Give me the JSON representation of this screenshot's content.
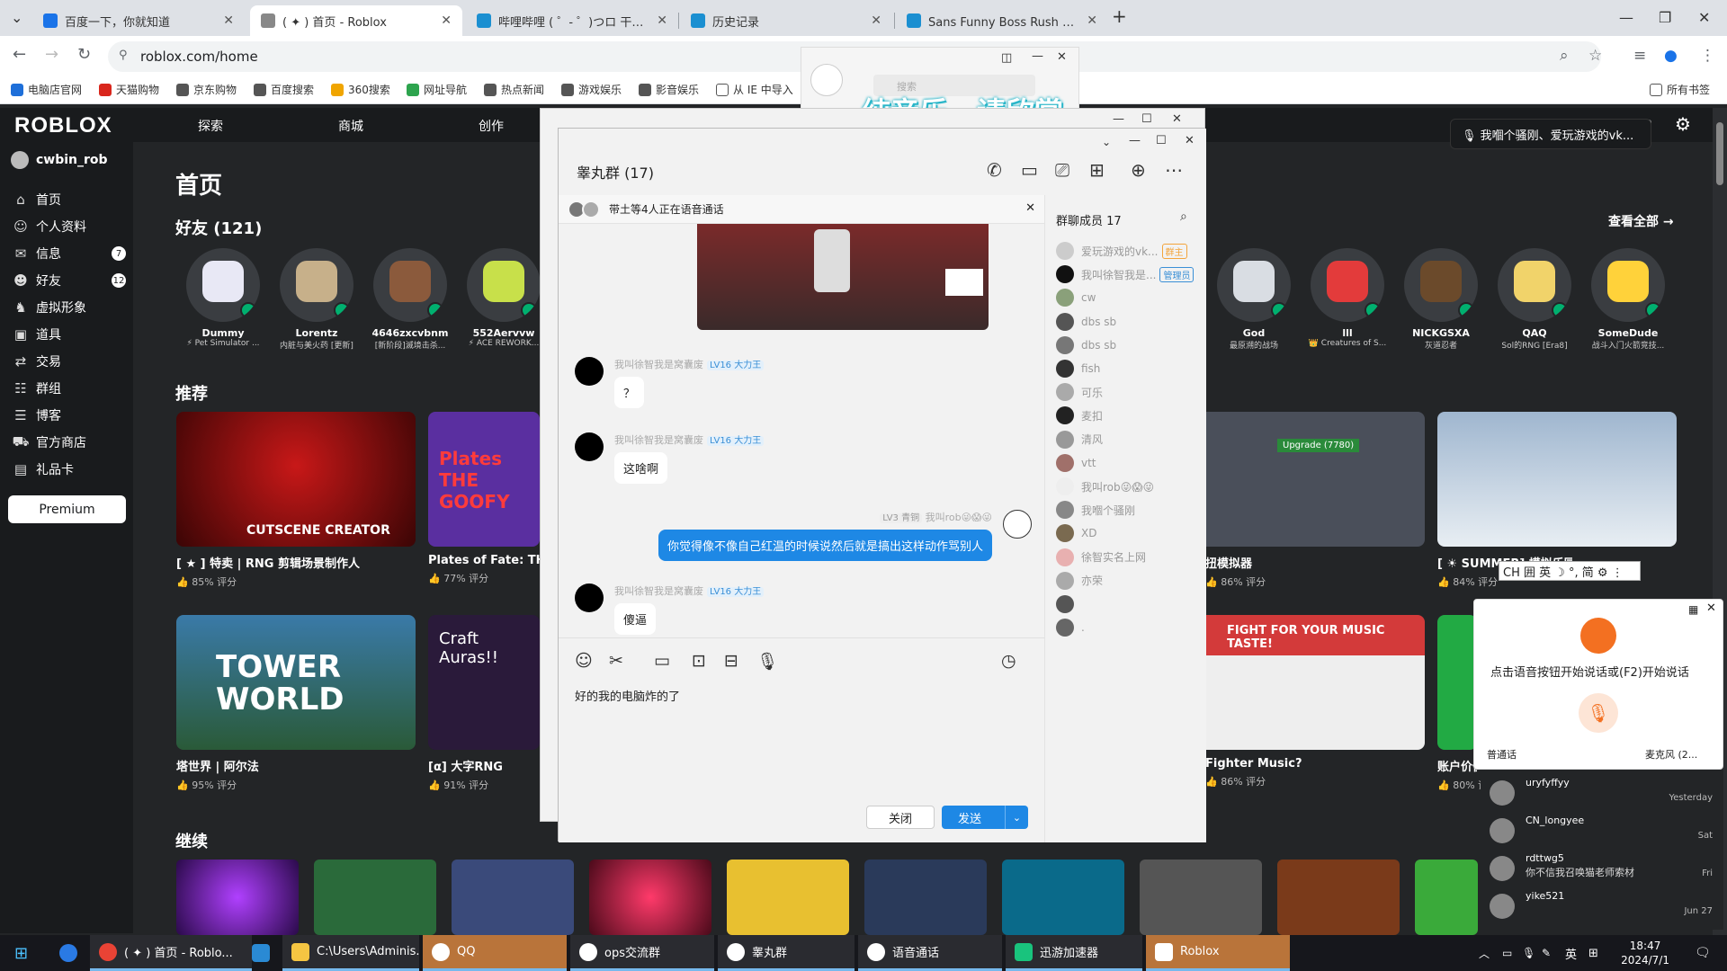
{
  "browser": {
    "tabs": [
      {
        "title": "百度一下，你就知道",
        "color": "#3b5fe6"
      },
      {
        "title": "( ✦ ) 首页 - Roblox",
        "color": "#555555"
      },
      {
        "title": "哔哩哔哩 ( ゜- ゜)つロ 干杯~-bi",
        "color": "#1b8fd1"
      },
      {
        "title": "历史记录",
        "color": "#1b8fd1"
      },
      {
        "title": "Sans Funny Boss Rush 困难模",
        "color": "#1b8fd1"
      }
    ],
    "url": "roblox.com/home",
    "bookmarks": [
      {
        "label": "电脑店官网",
        "color": "#1e6fd9"
      },
      {
        "label": "天猫购物",
        "color": "#d9261c"
      },
      {
        "label": "京东购物",
        "color": "#555555"
      },
      {
        "label": "百度搜索",
        "color": "#555555"
      },
      {
        "label": "360搜索",
        "color": "#f0a500"
      },
      {
        "label": "网址导航",
        "color": "#2da44e"
      },
      {
        "label": "热点新闻",
        "color": "#555555"
      },
      {
        "label": "游戏娱乐",
        "color": "#555555"
      },
      {
        "label": "影音娱乐",
        "color": "#555555"
      },
      {
        "label": "从 IE 中导入",
        "color": "#555555"
      }
    ],
    "all_bookmarks": "所有书签"
  },
  "roblox": {
    "logo": "ROBLOX",
    "nav": [
      "探索",
      "商城",
      "创作"
    ],
    "username": "cwbin_rob",
    "sidebar": [
      {
        "label": "首页",
        "icon": "⌂"
      },
      {
        "label": "个人资料",
        "icon": "☺"
      },
      {
        "label": "信息",
        "icon": "✉",
        "badge": "7"
      },
      {
        "label": "好友",
        "icon": "☻",
        "badge": "12"
      },
      {
        "label": "虚拟形象",
        "icon": "♞"
      },
      {
        "label": "道具",
        "icon": "▣"
      },
      {
        "label": "交易",
        "icon": "⇄"
      },
      {
        "label": "群组",
        "icon": "☷"
      },
      {
        "label": "博客",
        "icon": "☰"
      },
      {
        "label": "官方商店",
        "icon": "⛟"
      },
      {
        "label": "礼品卡",
        "icon": "▤"
      }
    ],
    "premium": "Premium",
    "page_title": "首页",
    "friends_title": "好友 (121)",
    "see_all": "查看全部 →",
    "friends": [
      {
        "name": "Dummy",
        "status": "⚡ Pet Simulator ...",
        "color": "#e8e8f5"
      },
      {
        "name": "Lorentz",
        "status": "内脏与美火药 [更新]",
        "color": "#c7b08a"
      },
      {
        "name": "4646zxcvbnm",
        "status": "[新阶段]滅境击杀...",
        "color": "#8b5a3c"
      },
      {
        "name": "552Aervvw",
        "status": "⚡ ACE REWORK...",
        "color": "#c8e04a"
      },
      {
        "name": "God",
        "status": "最原溯的战场",
        "color": "#d9dde3"
      },
      {
        "name": "lll",
        "status": "👑 Creatures of S...",
        "color": "#e33b3b"
      },
      {
        "name": "NICKGSXA",
        "status": "灰道忍者",
        "color": "#6b4a2b"
      },
      {
        "name": "QAQ",
        "status": "Sol的RNG [Era8]",
        "color": "#f1d36a"
      },
      {
        "name": "SomeDude",
        "status": "战斗入门火箭竞技...",
        "color": "#ffd23a"
      }
    ],
    "recommended_title": "推荐",
    "games_row1": [
      {
        "title": "[ ★ ] 特卖 | RNG 剪辑场景制作人",
        "rating": "85% 评分",
        "thumb_text": "CUTSCENE CREATOR",
        "bg": "#7a0a0a"
      },
      {
        "title": "Plates of Fate: THE GOOFY",
        "rating": "77% 评分",
        "thumb_text": "Plates THE GOOFY",
        "bg": "#5a2fa0"
      },
      {
        "title": "扭模拟器",
        "rating": "86% 评分",
        "thumb_text": "Upgrade (7780)",
        "bg": "#4a4f5a"
      },
      {
        "title": "[ ☀ SUMMER] 模拟乐园",
        "rating": "84% 评分",
        "thumb_text": "",
        "bg": "#9fb6cf"
      }
    ],
    "games_row2": [
      {
        "title": "塔世界 | 阿尔法",
        "rating": "95% 评分",
        "thumb_text": "TOWER WORLD",
        "bg": "#3a7aa8"
      },
      {
        "title": "[α] 大字RNG",
        "rating": "91% 评分",
        "thumb_text": "Craft Auras!!",
        "bg": "#2a1a3a"
      },
      {
        "title": "Fighter Music?",
        "rating": "86% 评分",
        "thumb_text": "FIGHT FOR YOUR MUSIC TASTE!",
        "bg": "#d33a3a"
      },
      {
        "title": "账户价值",
        "rating": "80% 评分",
        "thumb_text": "",
        "bg": "#22aa44"
      }
    ],
    "continue_title": "继续",
    "notification": "🎙 我嗰个骚刚、爱玩游戏的vk..."
  },
  "overlay_text": "纯音乐，请欣赏",
  "qq_mini": {
    "search_placeholder": "搜索"
  },
  "qq": {
    "title": "睾丸群 (17)",
    "voice_bar": "带土等4人正在语音通话",
    "messages": [
      {
        "sender": "我叫徐智我是窝囊废",
        "level": "LV16 大力王",
        "text": "？"
      },
      {
        "sender": "我叫徐智我是窝囊废",
        "level": "LV16 大力王",
        "text": "这啥啊"
      },
      {
        "sender": "我叫rob😜😱😜",
        "level": "LV3 青铜",
        "text": "你觉得像不像自己红温的时候说然后就是搞出这样动作骂别人",
        "mine": true
      },
      {
        "sender": "我叫徐智我是窝囊废",
        "level": "LV16 大力王",
        "text": "傻逼"
      }
    ],
    "compose_text": "好的我的电脑炸的了",
    "close_btn": "关闭",
    "send_btn": "发送",
    "members_title": "群聊成员 17",
    "members": [
      {
        "name": "爱玩游戏的vk...",
        "tag": "群主",
        "tag_color": "#f3a43b",
        "color": "#cccccc"
      },
      {
        "name": "我叫徐智我是...",
        "tag": "管理员",
        "tag_color": "#3a8fd6",
        "color": "#111111"
      },
      {
        "name": "cw",
        "color": "#8aa07a"
      },
      {
        "name": "dbs sb",
        "color": "#555555"
      },
      {
        "name": "dbs sb",
        "color": "#777777"
      },
      {
        "name": "fish",
        "color": "#333333"
      },
      {
        "name": "可乐",
        "color": "#aaaaaa"
      },
      {
        "name": "麦扣",
        "color": "#222222"
      },
      {
        "name": "清风",
        "color": "#999999"
      },
      {
        "name": "vtt",
        "color": "#a0706a"
      },
      {
        "name": "我叫rob😜😱😜",
        "color": "#eeeeee"
      },
      {
        "name": "我嗰个骚刚",
        "color": "#888888"
      },
      {
        "name": "XD",
        "color": "#7a6a50"
      },
      {
        "name": "徐智实名上网",
        "color": "#e8b0b0"
      },
      {
        "name": "亦荣",
        "color": "#aaaaaa"
      },
      {
        "name": "",
        "color": "#555555"
      },
      {
        "name": ".",
        "color": "#666666"
      }
    ]
  },
  "voice_assistant": {
    "hint": "点击语音按钮开始说话或(F2)开始说话",
    "mode": "普通话",
    "mic": "麦克风 (2..."
  },
  "ime": "CH 囲 英 ☽ °, 简 ⚙ ⋮",
  "roblox_messages": [
    {
      "name": "uryfyffyy",
      "snippet": "",
      "time": "Yesterday"
    },
    {
      "name": "CN_longyee",
      "snippet": "",
      "time": "Sat"
    },
    {
      "name": "rdttwg5",
      "snippet": "你不信我召唤猫老师索材",
      "time": "Fri"
    },
    {
      "name": "yike521",
      "snippet": "",
      "time": "Jun 27"
    }
  ],
  "taskbar": {
    "items": [
      {
        "label": "( ✦ ) 首页 - Roblo...",
        "color": "#e94335"
      },
      {
        "label": "C:\\Users\\Adminis...",
        "color": "#f5c542"
      },
      {
        "label": "QQ",
        "color": "#ffffff"
      },
      {
        "label": "ops交流群",
        "color": "#ffffff"
      },
      {
        "label": "睾丸群",
        "color": "#ffffff"
      },
      {
        "label": "语音通话",
        "color": "#ffffff"
      },
      {
        "label": "迅游加速器",
        "color": "#19c37d"
      },
      {
        "label": "Roblox",
        "color": "#ffffff"
      }
    ],
    "time": "18:47",
    "date": "2024/7/1",
    "tray_lang": "英"
  }
}
